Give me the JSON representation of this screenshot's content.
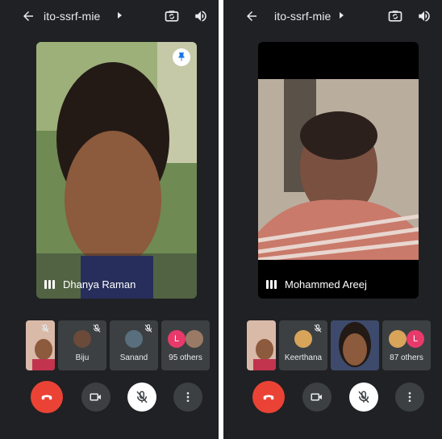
{
  "screens": [
    {
      "meeting_code": "ito-ssrf-mie",
      "main_speaker_name": "Dhanya Raman",
      "participants": [
        {
          "label": ""
        },
        {
          "label": "Biju"
        },
        {
          "label": "Sanand"
        },
        {
          "label": "95 others"
        }
      ],
      "others_avatar_letter": "L"
    },
    {
      "meeting_code": "ito-ssrf-mie",
      "main_speaker_name": "Mohammed Areej",
      "participants": [
        {
          "label": ""
        },
        {
          "label": "Keerthana"
        },
        {
          "label": ""
        },
        {
          "label": "87 others"
        }
      ],
      "others_avatar_letter": "L"
    }
  ],
  "icons": {
    "back": "arrow-left-icon",
    "caret": "caret-right-icon",
    "switch_camera": "switch-camera-icon",
    "speaker": "speaker-icon",
    "pin": "pin-icon",
    "mic_off": "mic-off-icon",
    "end_call": "end-call-icon",
    "camera": "camera-icon",
    "more": "more-vert-icon"
  },
  "colors": {
    "background": "#202124",
    "tile": "#3c4043",
    "end_call": "#ea4335",
    "avatar_letter": "#e8396b",
    "pin_accent": "#1a73e8"
  }
}
